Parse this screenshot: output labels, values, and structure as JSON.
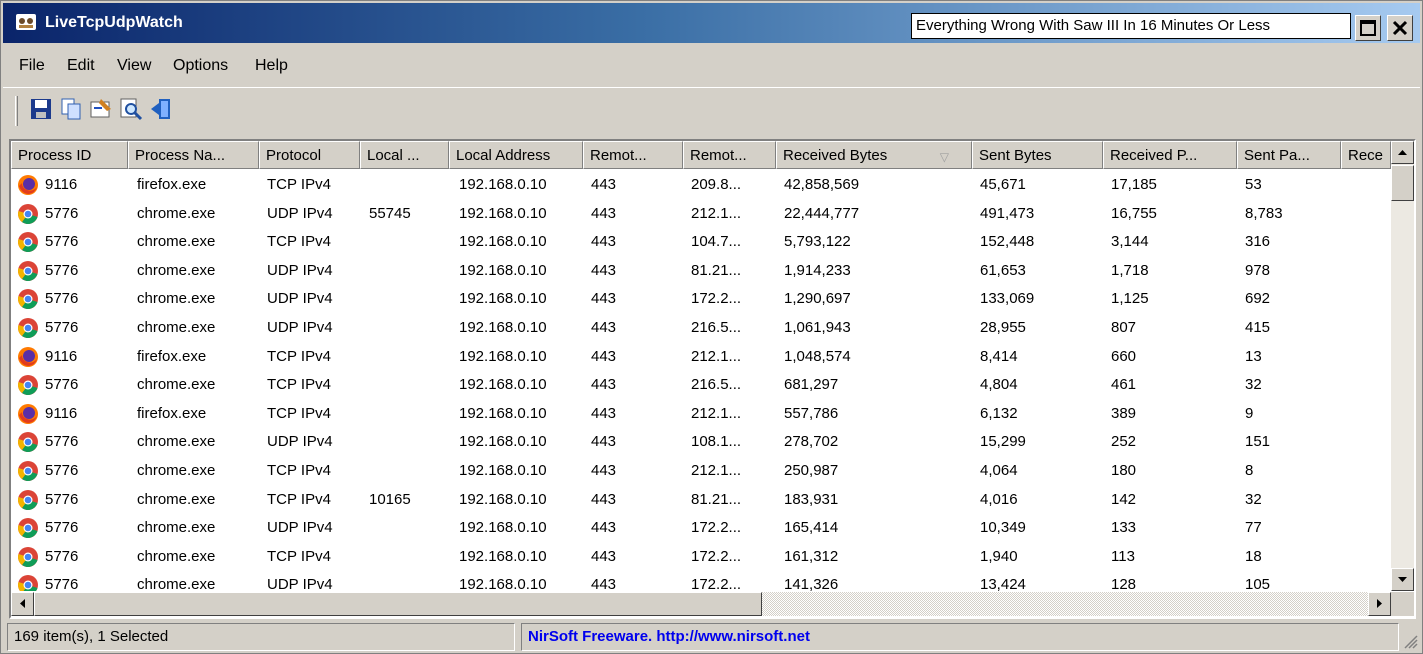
{
  "window": {
    "title": "LiveTcpUdpWatch",
    "tooltip": "Everything Wrong With Saw III In 16 Minutes Or Less"
  },
  "menu": [
    "File",
    "Edit",
    "View",
    "Options",
    "Help"
  ],
  "toolbar": [
    "save-icon",
    "copy-icon",
    "properties-icon",
    "find-icon",
    "exit-icon"
  ],
  "columns": [
    "Process ID",
    "Process Na...",
    "Protocol",
    "Local ...",
    "Local Address",
    "Remot...",
    "Remot...",
    "Received Bytes",
    "Sent Bytes",
    "Received P...",
    "Sent Pa...",
    "Rece"
  ],
  "rows": [
    {
      "browser": "firefox",
      "pid": "9116",
      "name": "firefox.exe",
      "protocol": "TCP IPv4",
      "lport": "",
      "laddr": "192.168.0.10",
      "rport": "443",
      "raddr": "209.8...",
      "rbytes": "42,858,569",
      "sbytes": "45,671",
      "rpkts": "17,185",
      "spkts": "53"
    },
    {
      "browser": "chrome",
      "pid": "5776",
      "name": "chrome.exe",
      "protocol": "UDP IPv4",
      "lport": "55745",
      "laddr": "192.168.0.10",
      "rport": "443",
      "raddr": "212.1...",
      "rbytes": "22,444,777",
      "sbytes": "491,473",
      "rpkts": "16,755",
      "spkts": "8,783"
    },
    {
      "browser": "chrome",
      "pid": "5776",
      "name": "chrome.exe",
      "protocol": "TCP IPv4",
      "lport": "",
      "laddr": "192.168.0.10",
      "rport": "443",
      "raddr": "104.7...",
      "rbytes": "5,793,122",
      "sbytes": "152,448",
      "rpkts": "3,144",
      "spkts": "316"
    },
    {
      "browser": "chrome",
      "pid": "5776",
      "name": "chrome.exe",
      "protocol": "UDP IPv4",
      "lport": "",
      "laddr": "192.168.0.10",
      "rport": "443",
      "raddr": "81.21...",
      "rbytes": "1,914,233",
      "sbytes": "61,653",
      "rpkts": "1,718",
      "spkts": "978"
    },
    {
      "browser": "chrome",
      "pid": "5776",
      "name": "chrome.exe",
      "protocol": "UDP IPv4",
      "lport": "",
      "laddr": "192.168.0.10",
      "rport": "443",
      "raddr": "172.2...",
      "rbytes": "1,290,697",
      "sbytes": "133,069",
      "rpkts": "1,125",
      "spkts": "692"
    },
    {
      "browser": "chrome",
      "pid": "5776",
      "name": "chrome.exe",
      "protocol": "UDP IPv4",
      "lport": "",
      "laddr": "192.168.0.10",
      "rport": "443",
      "raddr": "216.5...",
      "rbytes": "1,061,943",
      "sbytes": "28,955",
      "rpkts": "807",
      "spkts": "415"
    },
    {
      "browser": "firefox",
      "pid": "9116",
      "name": "firefox.exe",
      "protocol": "TCP IPv4",
      "lport": "",
      "laddr": "192.168.0.10",
      "rport": "443",
      "raddr": "212.1...",
      "rbytes": "1,048,574",
      "sbytes": "8,414",
      "rpkts": "660",
      "spkts": "13"
    },
    {
      "browser": "chrome",
      "pid": "5776",
      "name": "chrome.exe",
      "protocol": "TCP IPv4",
      "lport": "",
      "laddr": "192.168.0.10",
      "rport": "443",
      "raddr": "216.5...",
      "rbytes": "681,297",
      "sbytes": "4,804",
      "rpkts": "461",
      "spkts": "32"
    },
    {
      "browser": "firefox",
      "pid": "9116",
      "name": "firefox.exe",
      "protocol": "TCP IPv4",
      "lport": "",
      "laddr": "192.168.0.10",
      "rport": "443",
      "raddr": "212.1...",
      "rbytes": "557,786",
      "sbytes": "6,132",
      "rpkts": "389",
      "spkts": "9"
    },
    {
      "browser": "chrome",
      "pid": "5776",
      "name": "chrome.exe",
      "protocol": "UDP IPv4",
      "lport": "",
      "laddr": "192.168.0.10",
      "rport": "443",
      "raddr": "108.1...",
      "rbytes": "278,702",
      "sbytes": "15,299",
      "rpkts": "252",
      "spkts": "151"
    },
    {
      "browser": "chrome",
      "pid": "5776",
      "name": "chrome.exe",
      "protocol": "TCP IPv4",
      "lport": "",
      "laddr": "192.168.0.10",
      "rport": "443",
      "raddr": "212.1...",
      "rbytes": "250,987",
      "sbytes": "4,064",
      "rpkts": "180",
      "spkts": "8"
    },
    {
      "browser": "chrome",
      "pid": "5776",
      "name": "chrome.exe",
      "protocol": "TCP IPv4",
      "lport": "10165",
      "laddr": "192.168.0.10",
      "rport": "443",
      "raddr": "81.21...",
      "rbytes": "183,931",
      "sbytes": "4,016",
      "rpkts": "142",
      "spkts": "32"
    },
    {
      "browser": "chrome",
      "pid": "5776",
      "name": "chrome.exe",
      "protocol": "UDP IPv4",
      "lport": "",
      "laddr": "192.168.0.10",
      "rport": "443",
      "raddr": "172.2...",
      "rbytes": "165,414",
      "sbytes": "10,349",
      "rpkts": "133",
      "spkts": "77"
    },
    {
      "browser": "chrome",
      "pid": "5776",
      "name": "chrome.exe",
      "protocol": "TCP IPv4",
      "lport": "",
      "laddr": "192.168.0.10",
      "rport": "443",
      "raddr": "172.2...",
      "rbytes": "161,312",
      "sbytes": "1,940",
      "rpkts": "113",
      "spkts": "18"
    },
    {
      "browser": "chrome",
      "pid": "5776",
      "name": "chrome.exe",
      "protocol": "UDP IPv4",
      "lport": "",
      "laddr": "192.168.0.10",
      "rport": "443",
      "raddr": "172.2...",
      "rbytes": "141,326",
      "sbytes": "13,424",
      "rpkts": "128",
      "spkts": "105"
    }
  ],
  "status": {
    "count": "169 item(s), 1 Selected",
    "credit": "NirSoft Freeware.  http://www.nirsoft.net"
  },
  "colors": {
    "title_start": "#0a246a",
    "title_end": "#a6caf0",
    "link": "#0000ee"
  }
}
